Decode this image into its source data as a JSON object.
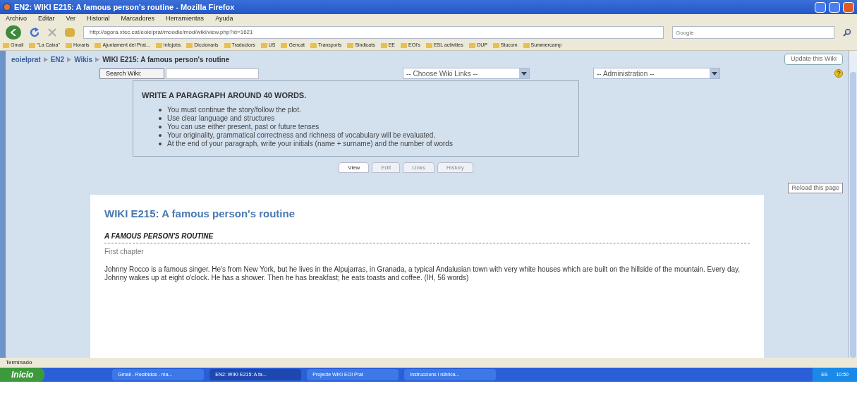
{
  "window": {
    "title": "EN2: WIKI E215: A famous person's routine - Mozilla Firefox"
  },
  "menu": [
    "Archivo",
    "Editar",
    "Ver",
    "Historial",
    "Marcadores",
    "Herramientas",
    "Ayuda"
  ],
  "address": {
    "value": "http://agora.xtec.cat/eoielprat/moodle/mod/wiki/view.php?id=1621"
  },
  "search": {
    "placeholder": "Google"
  },
  "bookmarks": [
    "Gmail",
    "\"La Caixa\"",
    "Horaris",
    "Ajuntament del Prat...",
    "Infojobs",
    "Diccionaris",
    "Traductors",
    "US",
    "Gencat",
    "Transports",
    "Sindicats",
    "EE",
    "EOI's",
    "ESL activities",
    "OUP",
    "Stucom",
    "Summercamp"
  ],
  "breadcrumb": [
    {
      "label": "eoielprat",
      "link": true
    },
    {
      "label": "EN2",
      "link": true
    },
    {
      "label": "Wikis",
      "link": true
    },
    {
      "label": "WIKI E215: A famous person's routine",
      "link": false
    }
  ],
  "update_button": "Update this Wiki",
  "search_wiki_button": "Search Wiki:",
  "wiki_links_select": "-- Choose Wiki Links --",
  "admin_select": "-- Administration --",
  "instructions": {
    "heading": "WRITE A PARAGRAPH AROUND 40 WORDS.",
    "items": [
      "You must continue the story/follow the plot.",
      "Use clear language and structures",
      "You can use either present, past or future tenses",
      "Your originality, grammatical correctness and richness of vocabulary will be evaluated.",
      "At the end of your paragraph, write your initials (name + surname) and the number of words"
    ]
  },
  "tabs": [
    {
      "label": "View",
      "selected": true
    },
    {
      "label": "Edit",
      "selected": false
    },
    {
      "label": "Links",
      "selected": false
    },
    {
      "label": "History",
      "selected": false
    }
  ],
  "reload_button": "Reload this page",
  "page": {
    "title": "WIKI E215: A famous person's routine",
    "subtitle": "A FAMOUS PERSON'S ROUTINE",
    "section": "First chapter",
    "body": "Johnny Rocco is a famous singer. He's from New York, but he lives in the Alpujarras, in Granada, a typical Andalusian town with very white houses which are built on the hillside of the mountain. Every day, Johnny wakes up at eight o'clock. He has a shower. Then he has breakfast; he eats toasts and coffee. (IH, 56 words)"
  },
  "status_bar": "Terminado",
  "taskbar": {
    "start": "Inicio",
    "tasks": [
      {
        "label": "Gmail - Recibidos - ma...",
        "selected": false
      },
      {
        "label": "EN2: WIKI E215: A fa...",
        "selected": true
      },
      {
        "label": "Projecte WIKI EOI Prat",
        "selected": false
      },
      {
        "label": "Instruccions i rúbrica...",
        "selected": false
      }
    ],
    "language": "ES",
    "clock": "10:50"
  }
}
